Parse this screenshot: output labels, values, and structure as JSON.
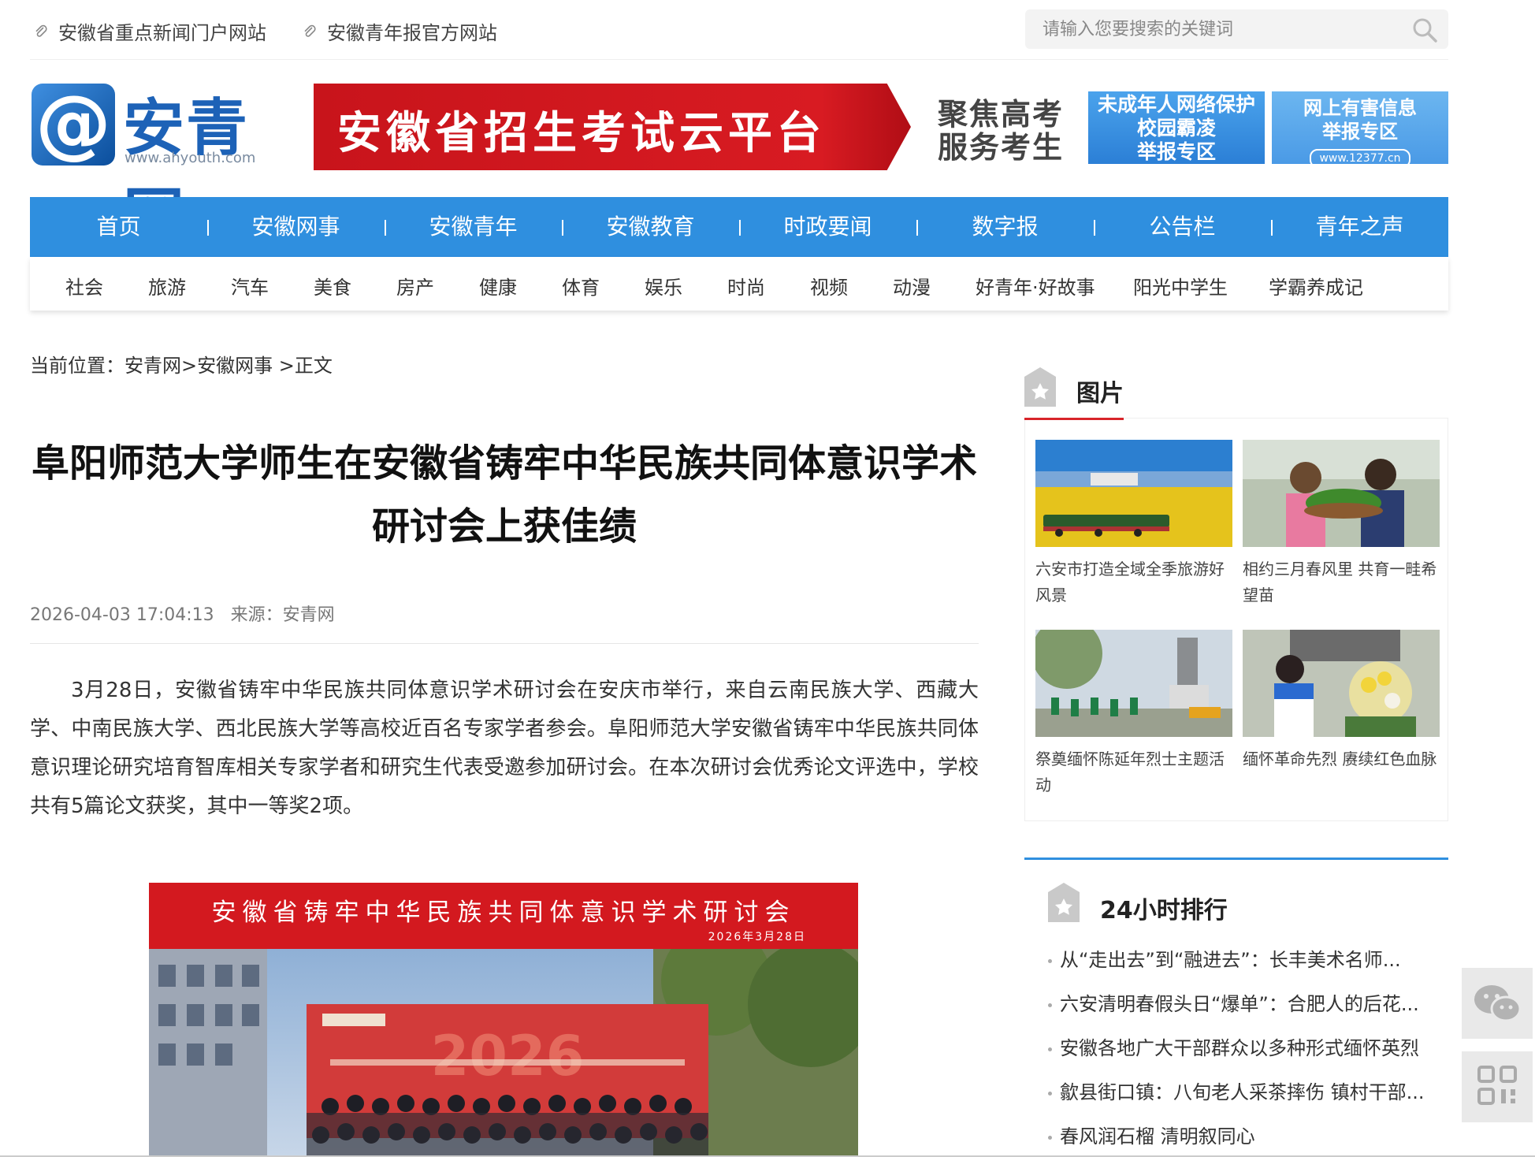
{
  "topbar": {
    "link1": "安徽省重点新闻门户网站",
    "link2": "安徽青年报官方网站",
    "search_placeholder": "请输入您要搜索的关键词"
  },
  "header": {
    "logo_text": "安青网",
    "logo_url": "www.ahyouth.com",
    "banner_main": "安徽省招生考试云平台",
    "banner_side_line1": "聚焦高考",
    "banner_side_line2": "服务考生",
    "badge1": [
      "未成年人网络保护",
      "校园霸凌",
      "举报专区"
    ],
    "badge2": [
      "网上有害信息",
      "举报专区",
      "www.12377.cn"
    ]
  },
  "nav": [
    "首页",
    "安徽网事",
    "安徽青年",
    "安徽教育",
    "时政要闻",
    "数字报",
    "公告栏",
    "青年之声"
  ],
  "subnav": [
    "社会",
    "旅游",
    "汽车",
    "美食",
    "房产",
    "健康",
    "体育",
    "娱乐",
    "时尚",
    "视频",
    "动漫",
    "好青年·好故事",
    "阳光中学生",
    "学霸养成记"
  ],
  "breadcrumb": "当前位置：安青网>安徽网事 >正文",
  "article": {
    "title_line1": "阜阳师范大学师生在安徽省铸牢中华民族共同体意识学术",
    "title_line2": "研讨会上获佳绩",
    "datetime": "2026-04-03 17:04:13",
    "source": "来源：安青网",
    "body": "3月28日，安徽省铸牢中华民族共同体意识学术研讨会在安庆市举行，来自云南民族大学、西藏大学、中南民族大学、西北民族大学等高校近百名专家学者参会。阜阳师范大学安徽省铸牢中华民族共同体意识理论研究培育智库相关专家学者和研究生代表受邀参加研讨会。在本次研讨会优秀论文评选中，学校共有5篇论文获奖，其中一等奖2项。",
    "photo_banner": "安徽省铸牢中华民族共同体意识学术研讨会",
    "photo_date": "2026年3月28日"
  },
  "sidebar": {
    "pics_title": "图片",
    "pics": [
      {
        "caption": "六安市打造全域全季旅游好风景"
      },
      {
        "caption": "相约三月春风里 共育一畦希望苗"
      },
      {
        "caption": "祭奠缅怀陈延年烈士主题活动"
      },
      {
        "caption": "缅怀革命先烈 赓续红色血脉"
      }
    ],
    "rank_title": "24小时排行",
    "rank": [
      "从“走出去”到“融进去”：长丰美术名师...",
      "六安清明春假头日“爆单”：合肥人的后花...",
      "安徽各地广大干部群众以多种形式缅怀英烈",
      "歙县街口镇：八旬老人采茶摔伤 镇村干部...",
      "春风润石榴 清明叙同心"
    ]
  },
  "colors": {
    "nav_blue": "#2f8fdf",
    "brand_red": "#d81b22",
    "logo_blue": "#1d62b7"
  }
}
